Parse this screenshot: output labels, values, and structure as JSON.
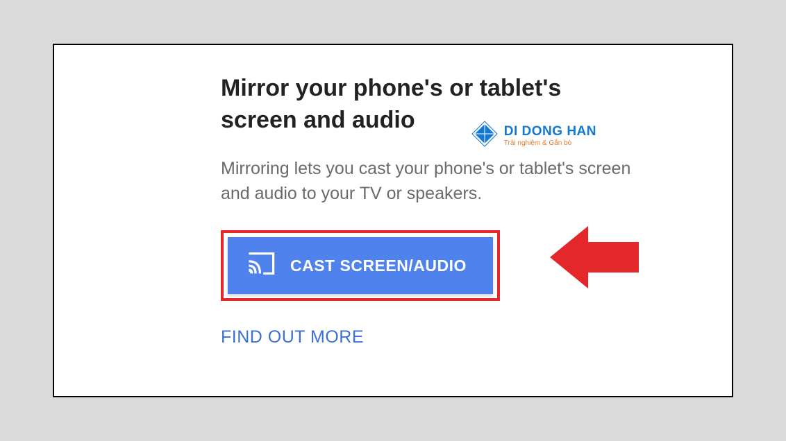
{
  "dialog": {
    "heading": "Mirror your phone's or tablet's screen and audio",
    "description": "Mirroring lets you cast your phone's or tablet's screen and audio to your TV or speakers.",
    "cast_button_label": "CAST SCREEN/AUDIO",
    "find_more_label": "FIND OUT MORE"
  },
  "watermark": {
    "brand": "DI DONG HAN",
    "tagline": "Trải nghiệm & Gắn bó"
  },
  "colors": {
    "button_bg": "#4f82ec",
    "highlight_border": "#e3272a",
    "link": "#3d6fd8",
    "logo_primary": "#1278d0"
  }
}
